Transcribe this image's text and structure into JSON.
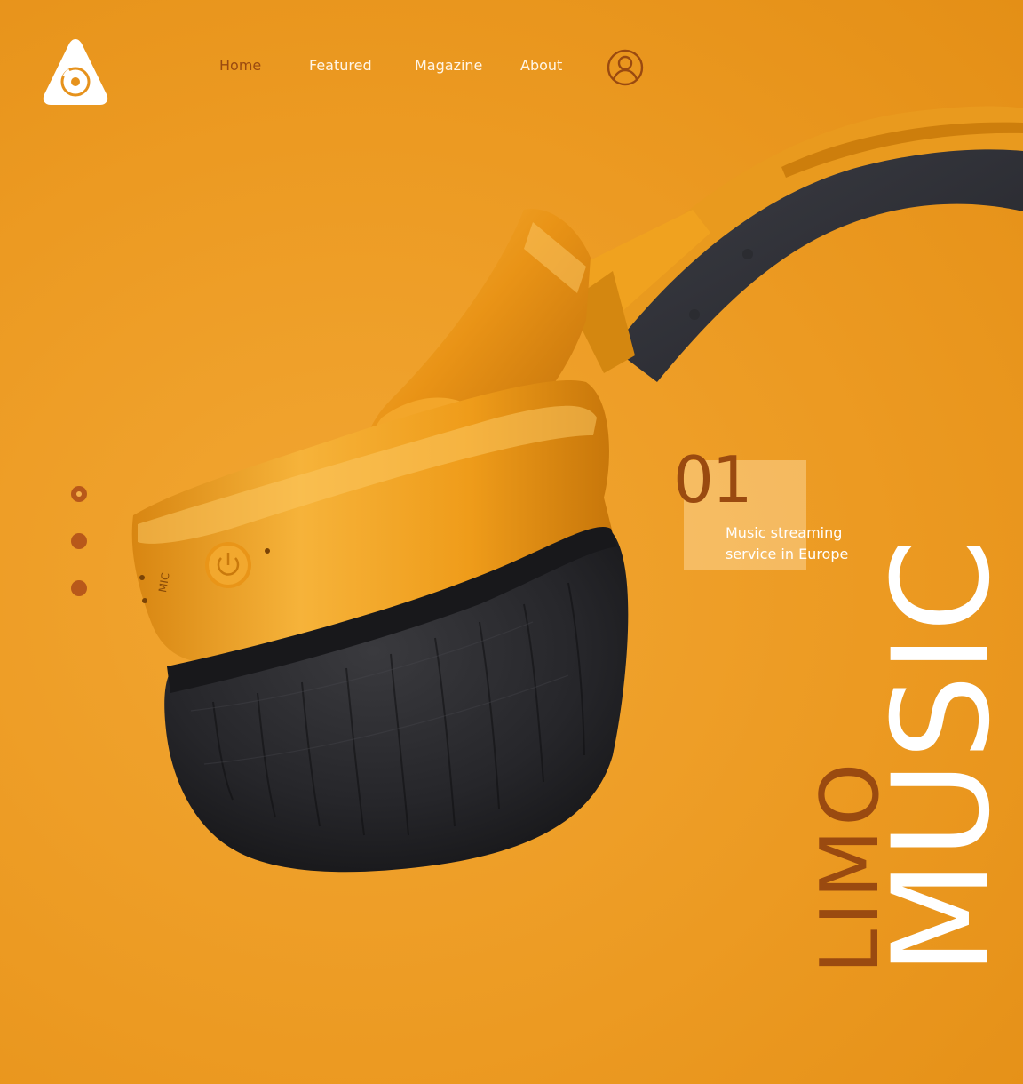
{
  "brand": {
    "logo_icon": "triangle-disc-logo"
  },
  "nav": {
    "items": [
      {
        "label": "Home",
        "active": true
      },
      {
        "label": "Featured",
        "active": false
      },
      {
        "label": "Magazine",
        "active": false
      },
      {
        "label": "About",
        "active": false
      }
    ],
    "user_icon": "user-circle-icon"
  },
  "hero": {
    "image": "orange-headphones-photo",
    "slide_number": "01",
    "description": "Music streaming service in Europe",
    "title_small": "LIMO",
    "title_large": "MUSIC",
    "slides": {
      "count": 3,
      "active_index": 0
    }
  },
  "colors": {
    "background": "#ec9a22",
    "accent_dark": "#9a4a10",
    "dot": "#b8581a",
    "text_light": "#ffffff"
  }
}
